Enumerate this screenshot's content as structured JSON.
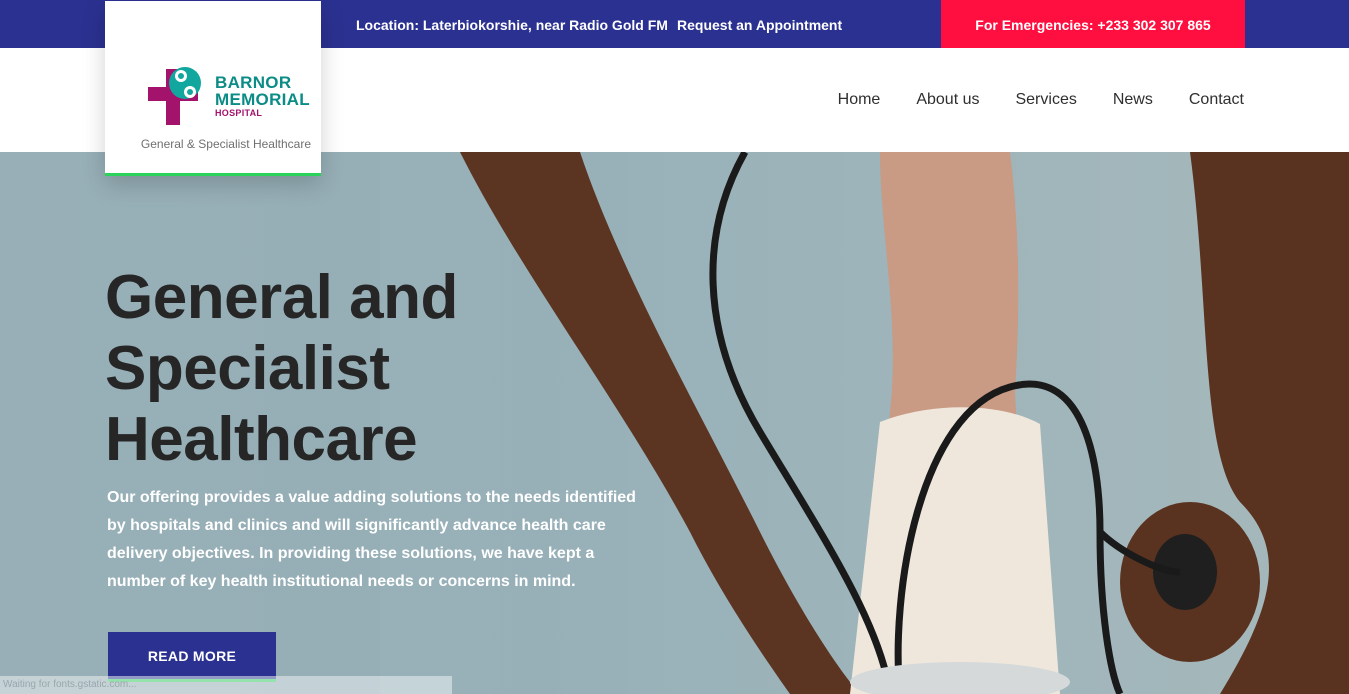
{
  "topbar": {
    "location": "Location: Laterbiokorshie, near Radio Gold FM",
    "appointment": "Request an Appointment",
    "emergency": "For Emergencies: +233 302 307 865"
  },
  "logo": {
    "name_line1": "BARNOR",
    "name_line2": "MEMORIAL",
    "name_line3": "HOSPITAL",
    "tagline": "General & Specialist Healthcare"
  },
  "nav": [
    "Home",
    "About us",
    "Services",
    "News",
    "Contact"
  ],
  "hero": {
    "title_line1": "General and",
    "title_line2": "Specialist",
    "title_line3": "Healthcare",
    "text": "Our offering provides a value adding solutions to the needs identified by hospitals and clinics and will significantly advance health care delivery objectives. In providing these solutions, we have kept a number of key health institutional needs or concerns in mind.",
    "button": "READ MORE"
  },
  "status": "Waiting for fonts.gstatic.com...",
  "colors": {
    "primary": "#2b3190",
    "emergency": "#ff0f3f",
    "accent_green": "#2bd35a",
    "logo_teal": "#0b8c86",
    "logo_magenta": "#a3136b"
  }
}
